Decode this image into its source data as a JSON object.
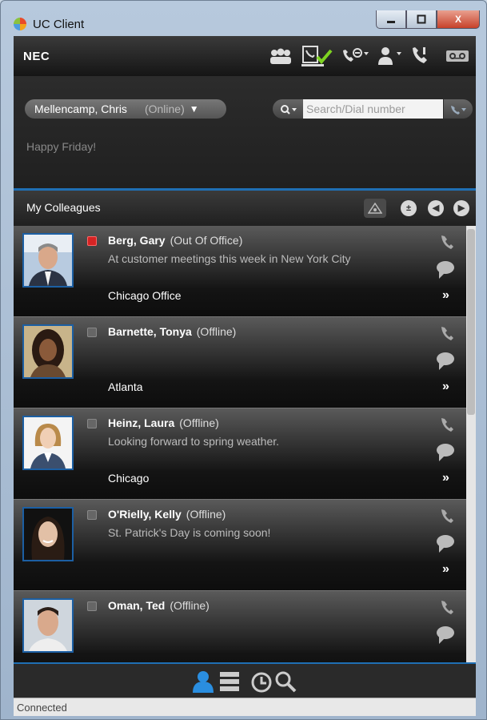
{
  "window": {
    "title": "UC Client",
    "close_label": "X"
  },
  "brand": "NEC",
  "user": {
    "name": "Mellencamp, Chris",
    "state": "(Online)",
    "status_message": "Happy Friday!"
  },
  "search": {
    "placeholder": "Search/Dial number"
  },
  "section": {
    "title": "My Colleagues"
  },
  "contacts": [
    {
      "name": "Berg, Gary",
      "state": "(Out Of Office)",
      "note": "At customer meetings this week in New York City",
      "location": "Chicago Office",
      "presence": "out-of-office"
    },
    {
      "name": "Barnette, Tonya",
      "state": "(Offline)",
      "note": "",
      "location": "Atlanta",
      "presence": "offline"
    },
    {
      "name": "Heinz, Laura",
      "state": "(Offline)",
      "note": "Looking forward to spring weather.",
      "location": "Chicago",
      "presence": "offline"
    },
    {
      "name": "O'Rielly, Kelly",
      "state": "(Offline)",
      "note": "St. Patrick's Day is coming soon!",
      "location": "",
      "presence": "offline"
    },
    {
      "name": "Oman, Ted",
      "state": "(Offline)",
      "note": "",
      "location": "",
      "presence": "offline"
    }
  ],
  "statusbar": {
    "text": "Connected"
  },
  "colors": {
    "accent": "#1f6fb4",
    "out_of_office": "#d52424",
    "offline": "#666666"
  }
}
